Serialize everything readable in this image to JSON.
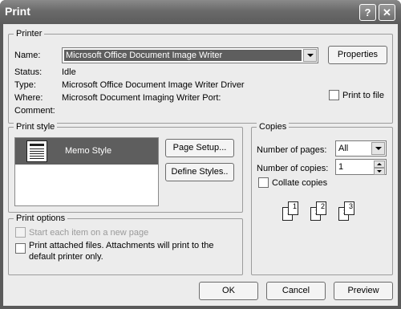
{
  "window": {
    "title": "Print"
  },
  "titlebar": {
    "help_glyph": "?",
    "close_glyph": "✕"
  },
  "printer": {
    "group_label": "Printer",
    "name_label": "Name:",
    "name_value": "Microsoft Office Document Image Writer",
    "properties_label": "Properties",
    "status_label": "Status:",
    "status_value": "Idle",
    "type_label": "Type:",
    "type_value": "Microsoft Office Document Image Writer Driver",
    "where_label": "Where:",
    "where_value": "Microsoft Document Imaging Writer Port:",
    "comment_label": "Comment:",
    "comment_value": "",
    "print_to_file_label": "Print to file",
    "print_to_file_checked": false
  },
  "print_style": {
    "group_label": "Print style",
    "items": [
      "Memo Style"
    ],
    "selected": "Memo Style",
    "page_setup_label": "Page Setup...",
    "define_styles_label": "Define Styles.."
  },
  "copies": {
    "group_label": "Copies",
    "pages_label": "Number of pages:",
    "pages_value": "All",
    "copies_label": "Number of copies:",
    "copies_value": "1",
    "collate_label": "Collate copies",
    "collate_checked": false,
    "collate_pages": [
      "1",
      "1",
      "2",
      "2",
      "3",
      "3"
    ]
  },
  "print_options": {
    "group_label": "Print options",
    "start_new_page_label": "Start each item on a new page",
    "attached_line1": "Print attached files.  Attachments will print to the",
    "attached_line2": "default printer only."
  },
  "footer": {
    "ok_label": "OK",
    "cancel_label": "Cancel",
    "preview_label": "Preview"
  }
}
